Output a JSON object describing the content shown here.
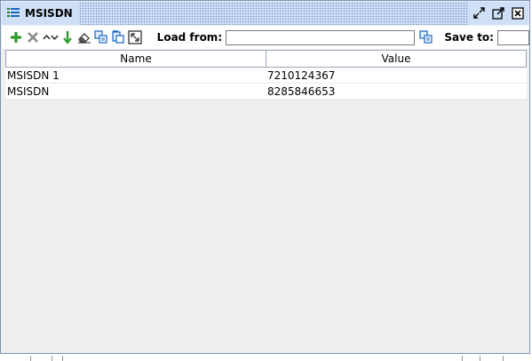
{
  "panel": {
    "title": "MSISDN",
    "title_icon": "list-icon",
    "controls": [
      "restore-icon",
      "maximize-icon",
      "close-icon"
    ]
  },
  "toolbar": {
    "icons": [
      "add-icon",
      "delete-icon",
      "move-up-down-icon",
      "import-icon",
      "eraser-icon",
      "copy-icon",
      "paste-icon",
      "fit-icon"
    ],
    "load_label": "Load from:",
    "load_value": "",
    "load_browse_icon": "browse-icon",
    "save_label": "Save to:",
    "save_value": ""
  },
  "table": {
    "columns": [
      "Name",
      "Value"
    ],
    "rows": [
      {
        "name": "MSISDN 1",
        "value": "7210124367"
      },
      {
        "name": "MSISDN",
        "value": "8285846653"
      }
    ]
  },
  "colors": {
    "title_bg": "#cfe0f6",
    "border": "#7a93b8",
    "add_green": "#2e9b2e",
    "delete_gray": "#8a8a8a"
  }
}
